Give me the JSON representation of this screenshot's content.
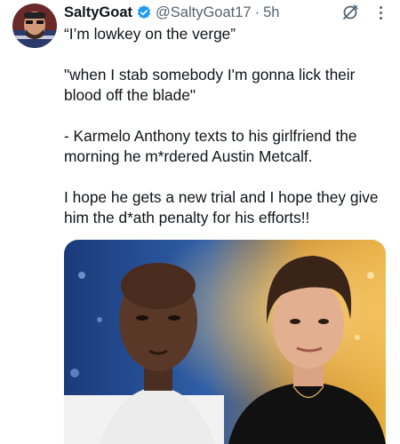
{
  "author": {
    "name": "SaltyGoat",
    "handle": "@SaltyGoat17",
    "separator": "·",
    "time": "5h",
    "verified_icon": "verified-badge-icon",
    "avatar_icon": "avatar"
  },
  "tweet": {
    "line1": "“I’m lowkey on the verge”",
    "para2": "\"when I stab somebody I'm gonna lick their blood off the blade\"",
    "para3": "- Karmelo Anthony texts to his girlfriend the morning he m*rdered Austin Metcalf.",
    "para4": "I hope he gets a new trial and I hope they give him the d*ath penalty for his efforts!!"
  },
  "icons": {
    "grok": "grok-icon",
    "more": "more-icon"
  },
  "colors": {
    "text": "#0f1419",
    "secondary": "#536471",
    "verified": "#1d9bf0"
  }
}
